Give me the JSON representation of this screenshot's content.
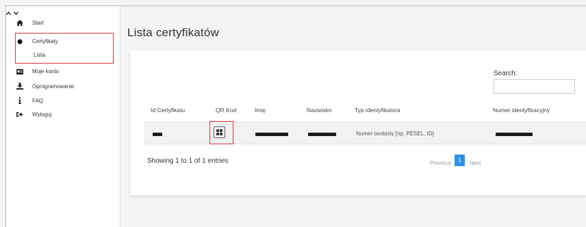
{
  "sidebar": {
    "items": [
      {
        "label": "Start",
        "icon": "home-icon"
      },
      {
        "label": "Certyfikaty",
        "icon": "circle-icon"
      },
      {
        "label": "Moje konto",
        "icon": "id-card-icon"
      },
      {
        "label": "Oprogramowanie",
        "icon": "download-icon"
      },
      {
        "label": "FAQ",
        "icon": "info-icon"
      },
      {
        "label": "Wyloguj",
        "icon": "sign-out-icon"
      }
    ],
    "sub_items": [
      {
        "label": "Lista"
      }
    ]
  },
  "main": {
    "title": "Lista certyfikatów",
    "search_label": "Search:",
    "search_value": "",
    "table": {
      "columns": [
        "Id Certyfikatu",
        "QR Kod",
        "Imię",
        "Nazwisko",
        "Typ identyfikatora",
        "Numer identyfikacyjny"
      ],
      "rows": [
        {
          "typ_identyfikatora": "Numer osobisty [np. PESEL, ID]"
        }
      ]
    },
    "info": "Showing 1 to 1 of 1 entries",
    "pagination": {
      "previous": "Previous",
      "page": "1",
      "next": "Next"
    }
  },
  "colors": {
    "highlight": "#d9363e",
    "accent": "#2f8fe6"
  }
}
